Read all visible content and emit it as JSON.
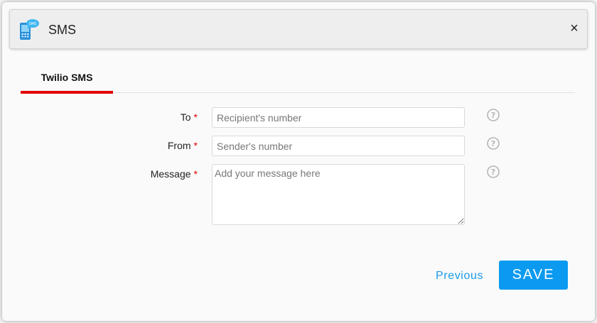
{
  "dialog": {
    "title": "SMS",
    "close_glyph": "×",
    "icon": "sms-phone-icon"
  },
  "tabs": [
    {
      "label": "Twilio SMS",
      "active": true
    }
  ],
  "form": {
    "to": {
      "label": "To",
      "required_mark": "*",
      "value": "",
      "placeholder": "Recipient's number"
    },
    "from": {
      "label": "From",
      "required_mark": "*",
      "value": "",
      "placeholder": "Sender's number"
    },
    "message": {
      "label": "Message",
      "required_mark": "*",
      "value": "",
      "placeholder": "Add your message here"
    }
  },
  "help_icon": "question-circle-icon",
  "footer": {
    "previous_label": "Previous",
    "save_label": "SAVE"
  },
  "colors": {
    "accent": "#0b9af0",
    "tab_underline": "#e00000",
    "required": "#e00000"
  }
}
